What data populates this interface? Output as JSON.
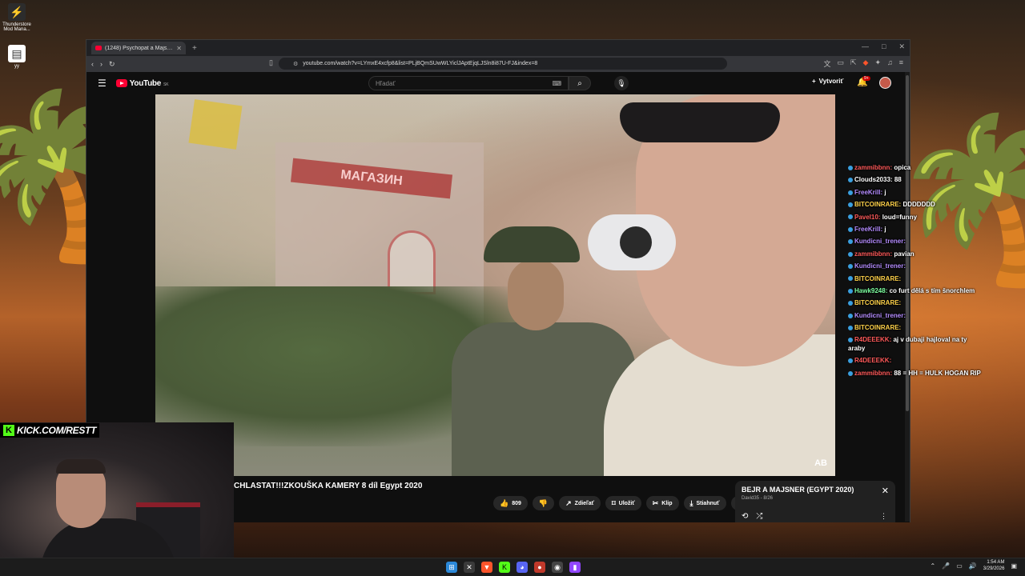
{
  "desktop": {
    "icons": [
      {
        "label": "Thunderstore Mod Mana...",
        "icon": "thunderstore-icon"
      },
      {
        "label": "yy",
        "icon": "file-icon"
      }
    ]
  },
  "browser": {
    "tab": {
      "title": "(1248) Psychopat a Majsner - ...",
      "icon": "youtube-favicon"
    },
    "url": "youtube.com/watch?v=LYmxE4xcfp8&list=PLjBQmSUwWLYiclJAptEjqLJSln8i87U-FJ&index=8",
    "window_controls": [
      "—",
      "□",
      "✕"
    ]
  },
  "youtube": {
    "logo_text": "YouTube",
    "country_code": "SK",
    "search_placeholder": "Hľadať",
    "create_label": "Vytvoriť",
    "notifications_badge": "9+",
    "video_title": "CHLASTAT!!!ZKOUŠKA KAMERY 8 díl Egypt 2020",
    "sign_text": "МАГАЗИН",
    "watermark": "AB",
    "actions": {
      "like_count": "809",
      "share_label": "Zdieľať",
      "save_label": "Uložiť",
      "clip_label": "Klip",
      "download_label": "Stiahnuť"
    },
    "playlist": {
      "title": "BEJR A MAJSNER (EGYPT 2020)",
      "subtitle": "David35 - 8/26"
    }
  },
  "chat": {
    "messages": [
      {
        "user": "zammibbnn:",
        "text": "opica",
        "color": "#ff5a5a"
      },
      {
        "user": "Clouds2033:",
        "text": "88",
        "color": "#ffffff"
      },
      {
        "user": "FreeKrill:",
        "text": "j",
        "color": "#b48cff"
      },
      {
        "user": "BITCOINRARE:",
        "text": "DDDDDDD",
        "color": "#ffd24a"
      },
      {
        "user": "Pavel10:",
        "text": "loud=funny",
        "color": "#ff5a5a"
      },
      {
        "user": "FreeKrill:",
        "text": "j",
        "color": "#b48cff"
      },
      {
        "user": "Kundicni_trener:",
        "text": "",
        "color": "#b48cff"
      },
      {
        "user": "zammibbnn:",
        "text": "pavian",
        "color": "#ff5a5a"
      },
      {
        "user": "Kundicni_trener:",
        "text": "",
        "color": "#b48cff"
      },
      {
        "user": "BITCOINRARE:",
        "text": "",
        "color": "#ffd24a"
      },
      {
        "user": "Hawk9248:",
        "text": "co furt dělá s tím šnorchlem",
        "color": "#7dffa0"
      },
      {
        "user": "BITCOINRARE:",
        "text": "",
        "color": "#ffd24a"
      },
      {
        "user": "Kundicni_trener:",
        "text": "",
        "color": "#b48cff"
      },
      {
        "user": "BITCOINRARE:",
        "text": "",
        "color": "#ffd24a"
      },
      {
        "user": "R4DEEEKK:",
        "text": "aj v dubaji hajloval na ty araby",
        "color": "#ff5a5a"
      },
      {
        "user": "R4DEEEKK:",
        "text": "",
        "color": "#ff5a5a"
      },
      {
        "user": "zammibbnn:",
        "text": "88 = HH = HULK HOGAN RIP",
        "color": "#ff5a5a"
      }
    ]
  },
  "stream": {
    "kick_letter": "K",
    "kick_url": "KICK.COM/RESTT"
  },
  "taskbar": {
    "time": "1:54 AM",
    "date": "3/29/2026",
    "apps": [
      "windows-start-icon",
      "xbox-icon",
      "brave-icon",
      "kick-icon",
      "discord-icon",
      "maps-pin-icon",
      "chrome-icon",
      "twitch-icon"
    ]
  }
}
